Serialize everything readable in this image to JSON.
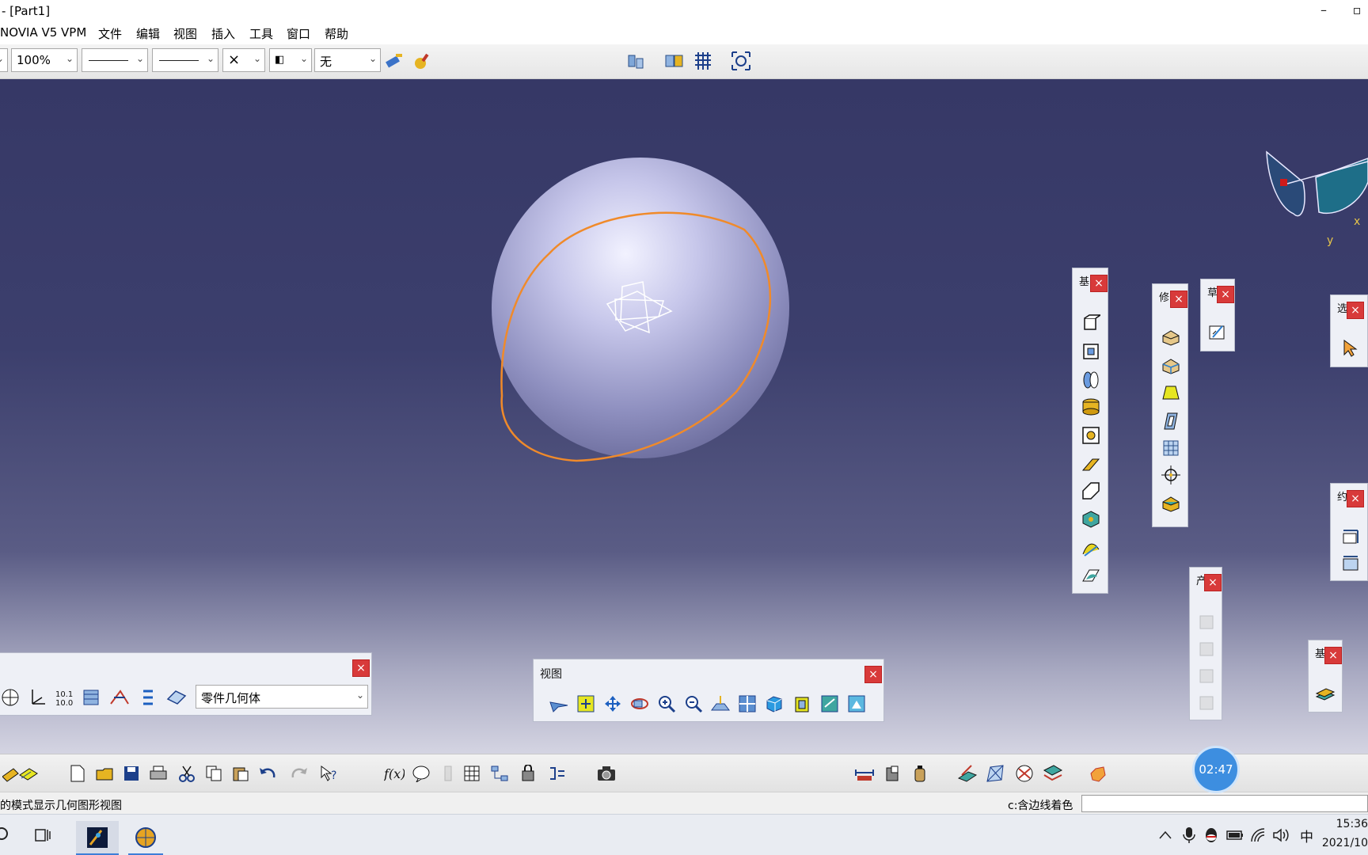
{
  "window": {
    "title": "- [Part1]",
    "minimize_glyph": "–",
    "restore_glyph": "▫"
  },
  "menu": [
    "NOVIA V5 VPM",
    "文件",
    "编辑",
    "视图",
    "插入",
    "工具",
    "窗口",
    "帮助"
  ],
  "toolbar": {
    "zoom_value": "100%",
    "layer_value": "无",
    "point_symbol": "×",
    "icons": [
      "paint-brush-icon",
      "format-painter-icon",
      "filter-icon",
      "hide-show-icon",
      "grid-icon",
      "fit-all-icon"
    ]
  },
  "compass": {
    "x_label": "x",
    "y_label": "y"
  },
  "panels": {
    "view": {
      "title": "视图",
      "close": "×"
    },
    "body_select": {
      "value": "零件几何体",
      "close": "×"
    },
    "sketch_based": {
      "title": "基",
      "close": "×"
    },
    "dress_up": {
      "title": "修",
      "close": "×"
    },
    "sketcher": {
      "title": "草",
      "close": "×"
    },
    "select": {
      "title": "选",
      "close": "×"
    },
    "measure": {
      "title": "约",
      "close": "×"
    },
    "product": {
      "title": "产",
      "close": "×"
    },
    "apply_material": {
      "title": "基",
      "close": "×"
    }
  },
  "status": {
    "left_text": "的模式显示几何图形视图",
    "right_text": "c:含边线着色"
  },
  "timer": "02:47",
  "taskbar": {
    "time": "15:36",
    "date": "2021/10",
    "ime": "中"
  }
}
